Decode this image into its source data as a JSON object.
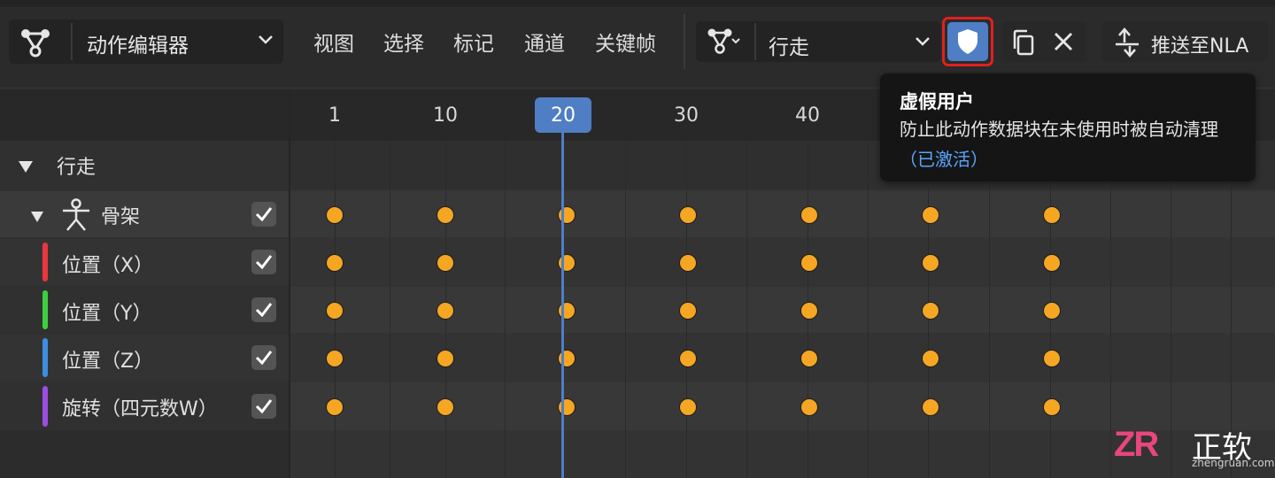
{
  "header": {
    "editor_type_label": "动作编辑器",
    "menus": [
      "视图",
      "选择",
      "标记",
      "通道",
      "关键帧"
    ],
    "action_name": "行走",
    "push_down_label": "推送至NLA"
  },
  "timeline": {
    "ticks": [
      "1",
      "10",
      "20",
      "30",
      "40"
    ],
    "current_frame": "20"
  },
  "tooltip": {
    "title": "虚假用户",
    "description": "防止此动作数据块在未使用时被自动清理",
    "status": "（已激活）"
  },
  "channels": {
    "action_summary": "行走",
    "armature": "骨架",
    "items": [
      {
        "label": "位置（X）",
        "color": "#e8383d"
      },
      {
        "label": "位置（Y）",
        "color": "#3ecf3e"
      },
      {
        "label": "位置（Z）",
        "color": "#3c8fe0"
      },
      {
        "label": "旋转（四元数W）",
        "color": "#9b4de0"
      }
    ]
  },
  "keyframes": {
    "frames": [
      1,
      10,
      20,
      30,
      40,
      50,
      60
    ]
  },
  "watermark": {
    "logo": "ZR",
    "brand": "正软",
    "url": "zhengruan.com"
  },
  "colors": {
    "accent": "#4f7ec4",
    "keyframe": "#f5a623",
    "highlight_border": "#e02020"
  }
}
